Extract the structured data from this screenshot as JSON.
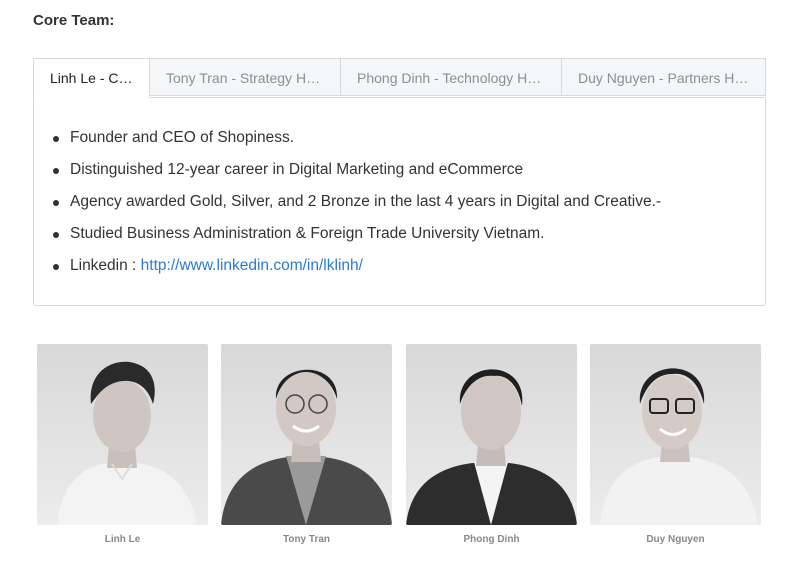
{
  "heading": "Core Team:",
  "tabs": [
    {
      "label": "Linh Le - CEO"
    },
    {
      "label": "Tony Tran - Strategy He..."
    },
    {
      "label": "Phong Dinh - Technology He..."
    },
    {
      "label": "Duy Nguyen - Partners He..."
    }
  ],
  "active_tab": {
    "bullets": [
      "Founder and CEO of Shopiness.",
      "Distinguished 12-year career in Digital Marketing and eCommerce",
      "Agency awarded Gold, Silver, and 2 Bronze in the last 4 years in Digital and Creative.-",
      "Studied Business Administration & Foreign Trade University Vietnam."
    ],
    "linkedin_label": "Linkedin : ",
    "linkedin_url": "http://www.linkedin.com/in/lklinh/"
  },
  "team": [
    {
      "name": "Linh Le"
    },
    {
      "name": "Tony Tran"
    },
    {
      "name": "Phong Dinh"
    },
    {
      "name": "Duy Nguyen"
    }
  ],
  "colors": {
    "link": "#2a7bd1",
    "tab_inactive_bg": "#f5f6f7",
    "border": "#d9d9d9"
  }
}
